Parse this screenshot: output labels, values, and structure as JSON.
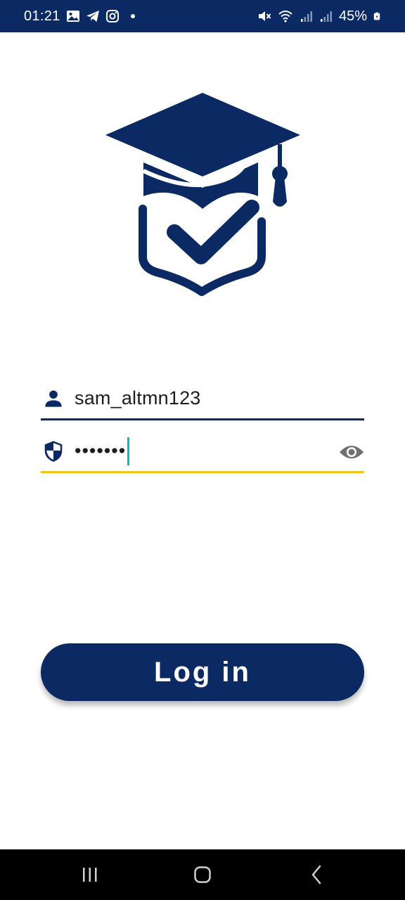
{
  "status_bar": {
    "time": "01:21",
    "battery_percent": "45%",
    "icons": [
      "gallery-icon",
      "telegram-icon",
      "instagram-icon",
      "notification-dot",
      "mute-icon",
      "wifi-icon",
      "signal-icon",
      "signal-icon",
      "battery-icon"
    ]
  },
  "logo": {
    "icon": "graduation-cap-check-icon",
    "color": "#0b2a63"
  },
  "login_form": {
    "username": {
      "icon": "person-icon",
      "value": "sam_altmn123"
    },
    "password": {
      "icon": "shield-icon",
      "value": "•••••••",
      "toggle_icon": "eye-icon"
    }
  },
  "login_button": {
    "label": "Log in"
  },
  "nav_bar": {
    "icons": [
      "recents-icon",
      "home-icon",
      "back-icon"
    ]
  },
  "colors": {
    "primary": "#0b2a63",
    "focus_underline": "#f0c419",
    "cursor": "#19b3b3"
  }
}
